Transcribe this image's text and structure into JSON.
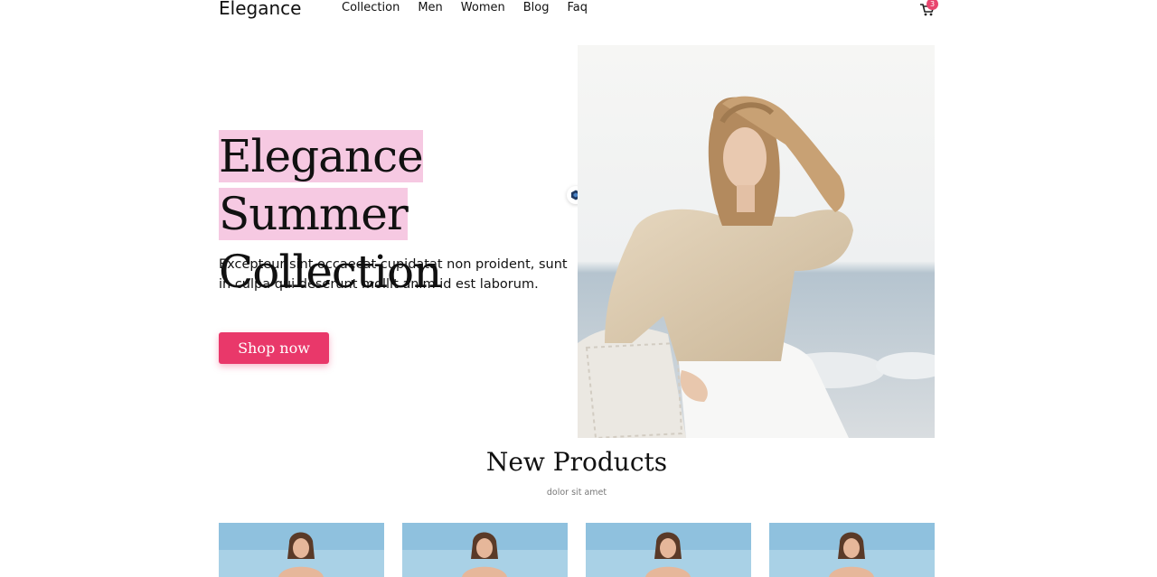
{
  "header": {
    "brand": "Elegance",
    "nav": [
      "Collection",
      "Men",
      "Women",
      "Blog",
      "Faq"
    ],
    "cart_icon": "shopping-cart-icon",
    "cart_count": "3",
    "badge_color": "#e8456e"
  },
  "hero": {
    "title_line1": "Elegance Summer",
    "title_line2": "Collection",
    "highlight_color": "#f6c9e2",
    "text": "Excepteur sint occaecat cupidatat non proident, sunt in culpa qui deserunt mollit anim id est laborum.",
    "button_label": "Shop now",
    "button_color": "#e9386a"
  },
  "new_products": {
    "title": "New Products",
    "subtitle": "dolor sit amet"
  }
}
